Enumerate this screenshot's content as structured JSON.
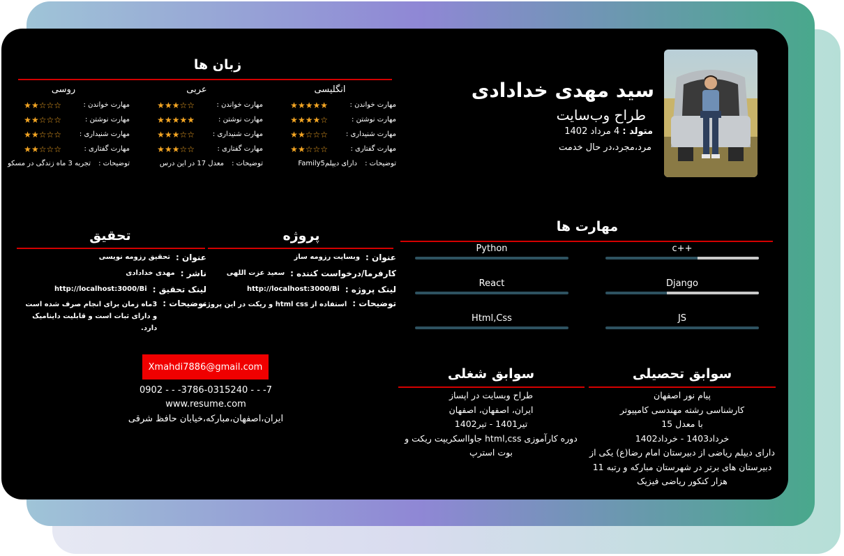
{
  "profile": {
    "name": "سید مهدی خدادادی",
    "job_title": "طراح وب‌سایت",
    "born_label": "متولد :",
    "born_value": "4 مرداد 1402",
    "status": "مرد،مجرد،در حال خدمت"
  },
  "languages": {
    "title": "زبان ها",
    "desc_label": "توضیحات :",
    "list": [
      {
        "name": "انگلیسی",
        "skills": [
          {
            "label": "مهارت خواندن :",
            "rating": 5
          },
          {
            "label": "مهارت نوشتن :",
            "rating": 4
          },
          {
            "label": "مهارت شنیداری :",
            "rating": 2
          },
          {
            "label": "مهارت گفتاری :",
            "rating": 2
          }
        ],
        "desc": "دارای دیپلمFamily5"
      },
      {
        "name": "عربی",
        "skills": [
          {
            "label": "مهارت خواندن :",
            "rating": 3
          },
          {
            "label": "مهارت نوشتن :",
            "rating": 5
          },
          {
            "label": "مهارت شنیداری :",
            "rating": 3
          },
          {
            "label": "مهارت گفتاری :",
            "rating": 3
          }
        ],
        "desc": "معدل 17 در این درس"
      },
      {
        "name": "روسی",
        "skills": [
          {
            "label": "مهارت خواندن :",
            "rating": 2
          },
          {
            "label": "مهارت نوشتن :",
            "rating": 2
          },
          {
            "label": "مهارت شنیداری :",
            "rating": 2
          },
          {
            "label": "مهارت گفتاری :",
            "rating": 2
          }
        ],
        "desc": "تجربه 3 ماه زندگی در مسکو"
      }
    ]
  },
  "project": {
    "title": "پروژه",
    "title_label": "عنوان :",
    "title_value": "وبسایت رزومه ساز",
    "client_label": "کارفرما/درخواست کننده :",
    "client_value": "سعید عزت اللهی",
    "link_label": "لینک پروژه :",
    "link_value": "http://localhost:3000/Bi",
    "desc_label": "توضیحات :",
    "desc_value": "استفاده از html css و ریکت در این پروژه"
  },
  "research": {
    "title": "تحقیق",
    "title_label": "عنوان :",
    "title_value": "تحقیق رزومه نویسی",
    "publisher_label": "ناشر :",
    "publisher_value": "مهدی خدادادی",
    "link_label": "لینک تحقیق :",
    "link_value": "http://localhost:3000/Bi",
    "desc_label": "توضیحات :",
    "desc_value": "3ماه زمان برای انجام صرف شده است و دارای ثبات است و قابلیت داینامیک دارد."
  },
  "skills": {
    "title": "مهارت ها",
    "items": [
      {
        "name": "c++",
        "level": 0.4
      },
      {
        "name": "Python",
        "level": 0.0
      },
      {
        "name": "Django",
        "level": 0.6
      },
      {
        "name": "React",
        "level": 0.0
      },
      {
        "name": "JS",
        "level": 0.0
      },
      {
        "name": "Html,Css",
        "level": 0.0
      }
    ],
    "colors": {
      "track": "#2e5260",
      "fill": "#c9c9c9"
    }
  },
  "contact": {
    "email": "Xmahdi7886@gmail.com",
    "phone": "0902 - - -3786-0315240 - - -7",
    "website": "www.resume.com",
    "address": "ایران،اصفهان،مبارکه،خیابان حافظ شرقی"
  },
  "education": {
    "title": "سوابق تحصیلی",
    "lines": [
      "پیام نور اصفهان",
      "کارشناسی رشته مهندسی کامپیوتر",
      "با معدل 15",
      "خرداد1403 - خرداد1402",
      "دارای دیپلم ریاضی از دبیرستان امام رضا(ع) یکی از دبیرستان های برتر در شهرستان مبارکه و رتبه 11 هزار کنکور ریاضی فیزیک"
    ]
  },
  "work": {
    "title": "سوابق شغلی",
    "lines": [
      "طراح وبسایت در اپساز",
      "ایران، اصفهان، اصفهان",
      "تیر1401 - تیر1402",
      "دوره کارآموزی html,css جاوااسکریپت ریکت و بوت استرپ"
    ]
  },
  "theme": {
    "accent": "#d40000",
    "email_bg": "#f00000",
    "star": "#f5a623"
  }
}
